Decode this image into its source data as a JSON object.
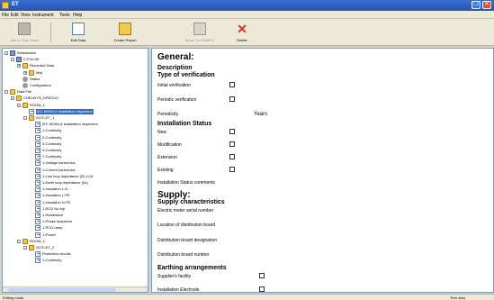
{
  "window": {
    "title": "ET"
  },
  "menu": [
    "File",
    "Edit",
    "View",
    "Instrument",
    "Tools",
    "Help"
  ],
  "toolbar": {
    "buttons": [
      {
        "label": "Add to Data Store",
        "disabled": true
      },
      {
        "label": "Edit Data",
        "disabled": false
      },
      {
        "label": "Create Report",
        "disabled": false
      },
      {
        "label": "Move Ctrl+Shift+C",
        "disabled": true
      },
      {
        "label": "Delete",
        "disabled": false
      }
    ]
  },
  "tree": {
    "nodes": [
      {
        "text": "Workstation",
        "icon": "pc",
        "level": 0,
        "expander": "-"
      },
      {
        "text": "C.P.44.06",
        "icon": "pc",
        "level": 1,
        "expander": "-"
      },
      {
        "text": "Recorded Data",
        "icon": "folder",
        "level": 2,
        "expander": "+"
      },
      {
        "text": "Mwi",
        "icon": "folder",
        "level": 3,
        "expander": "+"
      },
      {
        "text": "Status",
        "icon": "gear",
        "level": 2,
        "expander": ""
      },
      {
        "text": "Configuration",
        "icon": "gear",
        "level": 2,
        "expander": ""
      },
      {
        "text": "Data File",
        "icon": "folder",
        "level": 0,
        "expander": "-"
      },
      {
        "text": "CHELWYN_DRSCUS",
        "icon": "folder",
        "level": 1,
        "expander": "-"
      },
      {
        "text": "ROOM_1",
        "icon": "folder",
        "level": 2,
        "expander": "-"
      },
      {
        "text": "IEC 60364-6 Installation inspection",
        "icon": "doc",
        "level": 3,
        "expander": "",
        "selected": true
      },
      {
        "text": "OUTLET_1",
        "icon": "folder",
        "level": 3,
        "expander": "-"
      },
      {
        "text": "IEC 60364-6 Installation inspection",
        "icon": "doc",
        "level": 4,
        "expander": ""
      },
      {
        "text": "1-Continuity",
        "icon": "doc",
        "level": 4,
        "expander": ""
      },
      {
        "text": "2-Continuity",
        "icon": "doc",
        "level": 4,
        "expander": ""
      },
      {
        "text": "3-Continuity",
        "icon": "doc",
        "level": 4,
        "expander": ""
      },
      {
        "text": "4-Continuity",
        "icon": "doc",
        "level": 4,
        "expander": ""
      },
      {
        "text": "7-Continuity",
        "icon": "doc",
        "level": 4,
        "expander": ""
      },
      {
        "text": "1-Voltage harmonics",
        "icon": "doc",
        "level": 4,
        "expander": ""
      },
      {
        "text": "1-Current harmonics",
        "icon": "doc",
        "level": 4,
        "expander": ""
      },
      {
        "text": "1-Line loop impedance (Zi) Li-N",
        "icon": "doc",
        "level": 4,
        "expander": ""
      },
      {
        "text": "1-Earth loop impedance (Zs)",
        "icon": "doc",
        "level": 4,
        "expander": ""
      },
      {
        "text": "1-Insulation L-N",
        "icon": "doc",
        "level": 4,
        "expander": ""
      },
      {
        "text": "1-Insulation L-PE",
        "icon": "doc",
        "level": 4,
        "expander": ""
      },
      {
        "text": "1-Insulation N-PE",
        "icon": "doc",
        "level": 4,
        "expander": ""
      },
      {
        "text": "1-RCD No trip",
        "icon": "doc",
        "level": 4,
        "expander": ""
      },
      {
        "text": "1-Resistance",
        "icon": "doc",
        "level": 4,
        "expander": ""
      },
      {
        "text": "1-Phase sequence",
        "icon": "doc",
        "level": 4,
        "expander": ""
      },
      {
        "text": "1-RCD ramp",
        "icon": "doc",
        "level": 4,
        "expander": ""
      },
      {
        "text": "1-Power",
        "icon": "doc",
        "level": 4,
        "expander": ""
      },
      {
        "text": "ROOM_2",
        "icon": "folder",
        "level": 2,
        "expander": "-"
      },
      {
        "text": "OUTLET_2",
        "icon": "folder",
        "level": 3,
        "expander": "-"
      },
      {
        "text": "Protection circuits",
        "icon": "doc",
        "level": 4,
        "expander": ""
      },
      {
        "text": "1-Continuity",
        "icon": "doc",
        "level": 4,
        "expander": ""
      }
    ]
  },
  "form": {
    "general_heading": "General:",
    "description_heading": "Description",
    "type_heading": "Type of verification",
    "initial_verification": "Initial verification",
    "periodic_verification": "Periodic verification",
    "periodicity": "Periodicity",
    "periodicity_unit": "Years",
    "installation_status_heading": "Installation Status",
    "new": "New",
    "modification": "Modification",
    "extension": "Extension",
    "existing": "Existing",
    "status_comments": "Installation Status comments",
    "supply_heading": "Supply:",
    "supply_characteristics_heading": "Supply characteristics",
    "meter_serial": "Electric meter serial number",
    "distribution_location": "Location of distribution board",
    "distribution_designation": "Distribution board designation",
    "distribution_number": "Distribution board number",
    "earthing_heading": "Earthing arrangements",
    "supplier_facility": "Supplier's facility",
    "installation_electrode": "Installation Electrode"
  },
  "status": {
    "left": "Editing mode",
    "right": "Tree view"
  },
  "colors": {
    "titlebar": "#2353b3",
    "selection": "#316ac5",
    "delete_x": "#d9331f"
  }
}
